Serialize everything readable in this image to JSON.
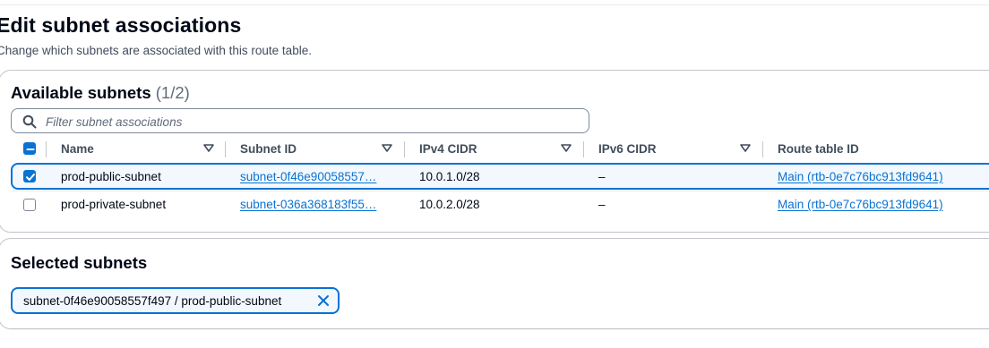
{
  "page": {
    "title": "Edit subnet associations",
    "description": "Change which subnets are associated with this route table."
  },
  "available": {
    "title": "Available subnets",
    "count": "(1/2)",
    "filter_placeholder": "Filter subnet associations",
    "filter_value": "",
    "columns": [
      "Name",
      "Subnet ID",
      "IPv4 CIDR",
      "IPv6 CIDR",
      "Route table ID"
    ],
    "rows": [
      {
        "selected": true,
        "name": "prod-public-subnet",
        "subnet_id": "subnet-0f46e90058557…",
        "ipv4": "10.0.1.0/28",
        "ipv6": "–",
        "route_table": "Main (rtb-0e7c76bc913fd9641)"
      },
      {
        "selected": false,
        "name": "prod-private-subnet",
        "subnet_id": "subnet-036a368183f55…",
        "ipv4": "10.0.2.0/28",
        "ipv6": "–",
        "route_table": "Main (rtb-0e7c76bc913fd9641)"
      }
    ]
  },
  "selected": {
    "title": "Selected subnets",
    "tokens": [
      "subnet-0f46e90058557f497 / prod-public-subnet"
    ]
  },
  "icons": {
    "search": "search-icon",
    "sort": "caret-down-icon",
    "dismiss": "close-icon",
    "select_all": "indeterminate-checkbox-icon",
    "checked": "checkmark-icon"
  },
  "colors": {
    "accent": "#0972d3",
    "selected_row_bg": "#f2f8fd",
    "text": "#000716",
    "muted": "#5f6b7a",
    "border": "#c6c6cd"
  }
}
